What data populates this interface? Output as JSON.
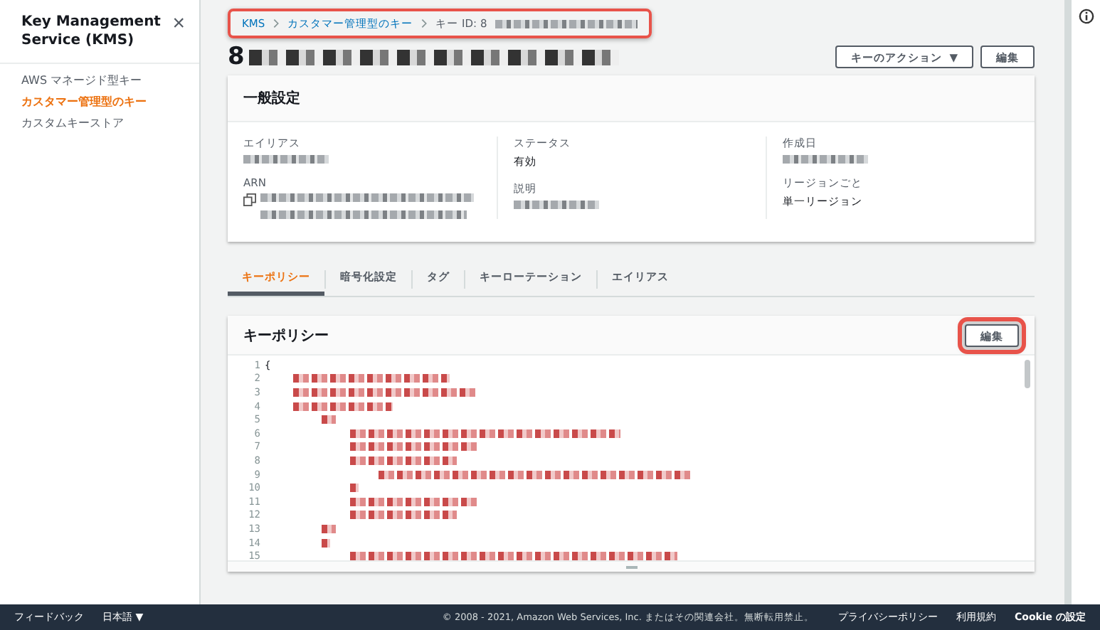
{
  "sidebar": {
    "title": "Key Management Service (KMS)",
    "close": "×",
    "items": [
      {
        "label": "AWS マネージド型キー",
        "selected": false
      },
      {
        "label": "カスタマー管理型のキー",
        "selected": true
      },
      {
        "label": "カスタムキーストア",
        "selected": false
      }
    ]
  },
  "breadcrumb": {
    "highlighted": true,
    "items": [
      {
        "label": "KMS",
        "link": true
      },
      {
        "label": "カスタマー管理型のキー",
        "link": true
      },
      {
        "label": "キー ID: 8",
        "link": false,
        "redacted": true
      }
    ]
  },
  "page_title": {
    "text": "8",
    "redacted": true
  },
  "actions": [
    {
      "label": "キーのアクション",
      "caret": "▼",
      "highlighted": false
    },
    {
      "label": "編集",
      "highlighted": false
    }
  ],
  "general": {
    "title": "一般設定",
    "columns": [
      [
        {
          "label": "エイリアス",
          "redacted": true
        },
        {
          "label": "ARN",
          "redacted": true,
          "copy": true
        }
      ],
      [
        {
          "label": "ステータス",
          "value": "有効"
        },
        {
          "label": "説明",
          "redacted": true
        }
      ],
      [
        {
          "label": "作成日",
          "redacted": true
        },
        {
          "label": "リージョンごと",
          "value": "単一リージョン"
        }
      ]
    ]
  },
  "tabs": [
    {
      "label": "キーポリシー",
      "selected": true
    },
    {
      "label": "暗号化設定",
      "selected": false
    },
    {
      "label": "タグ",
      "selected": false
    },
    {
      "label": "キーローテーション",
      "selected": false
    },
    {
      "label": "エイリアス",
      "selected": false
    }
  ],
  "policy": {
    "title": "キーポリシー",
    "edit": {
      "label": "編集",
      "highlighted": true
    },
    "lines": [
      {
        "number": "1",
        "text": "{"
      },
      {
        "number": "2",
        "redacted": true
      },
      {
        "number": "3",
        "redacted": true
      },
      {
        "number": "4",
        "redacted": true
      },
      {
        "number": "5",
        "redacted": true
      },
      {
        "number": "6",
        "redacted": true
      },
      {
        "number": "7",
        "redacted": true
      },
      {
        "number": "8",
        "redacted": true
      },
      {
        "number": "9",
        "redacted": true
      },
      {
        "number": "10",
        "redacted": true
      },
      {
        "number": "11",
        "redacted": true
      },
      {
        "number": "12",
        "redacted": true
      },
      {
        "number": "13",
        "redacted": true
      },
      {
        "number": "14",
        "redacted": true
      },
      {
        "number": "15",
        "redacted": true
      }
    ]
  },
  "footer": {
    "left": [
      {
        "label": "フィードバック"
      },
      {
        "label": "日本語",
        "caret": "▼"
      }
    ],
    "copyright": "© 2008 - 2021, Amazon Web Services, Inc. またはその関連会社。無断転用禁止。",
    "links": [
      "プライバシーポリシー",
      "利用規約",
      "Cookie の設定"
    ]
  }
}
